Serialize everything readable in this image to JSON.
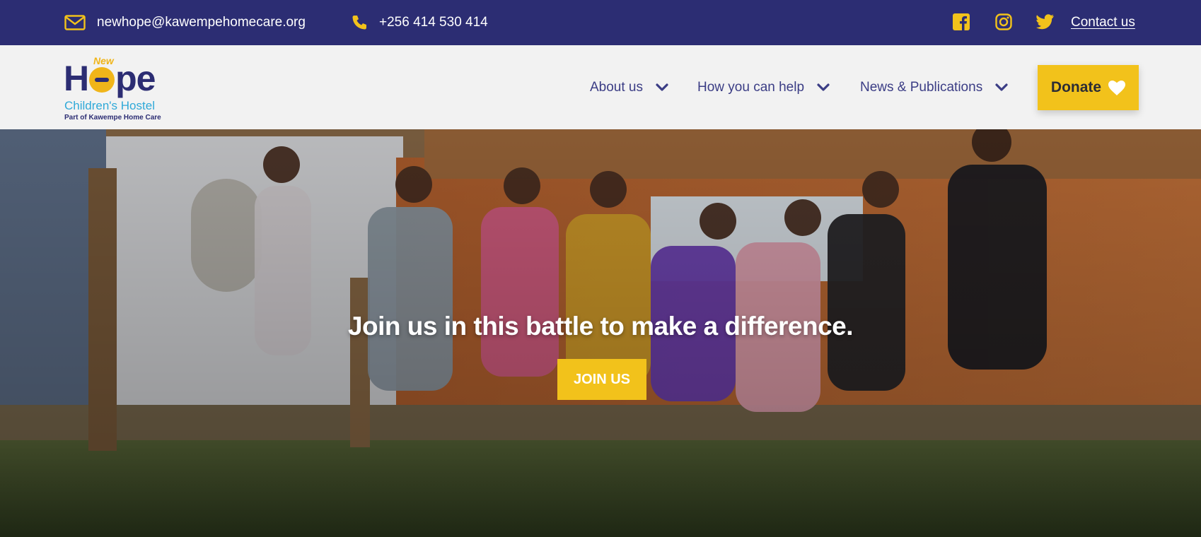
{
  "colors": {
    "brand_navy": "#2c2d73",
    "accent_yellow": "#f2c21b",
    "logo_blue": "#2fa9d8"
  },
  "topbar": {
    "email": "newhope@kawempehomecare.org",
    "phone": "+256 414 530 414",
    "contact": "Contact us",
    "icons": [
      "mail-icon",
      "phone-icon",
      "facebook-icon",
      "instagram-icon",
      "twitter-icon"
    ]
  },
  "logo": {
    "new": "New",
    "h": "H",
    "pe": "pe",
    "subtitle": "Children's Hostel",
    "tagline": "Part of Kawempe Home Care"
  },
  "nav": {
    "items": [
      {
        "label": "About us"
      },
      {
        "label": "How you can help"
      },
      {
        "label": "News & Publications"
      }
    ],
    "donate": "Donate"
  },
  "hero": {
    "heading": "Join us in this battle to make a difference.",
    "button": "JOIN US"
  }
}
